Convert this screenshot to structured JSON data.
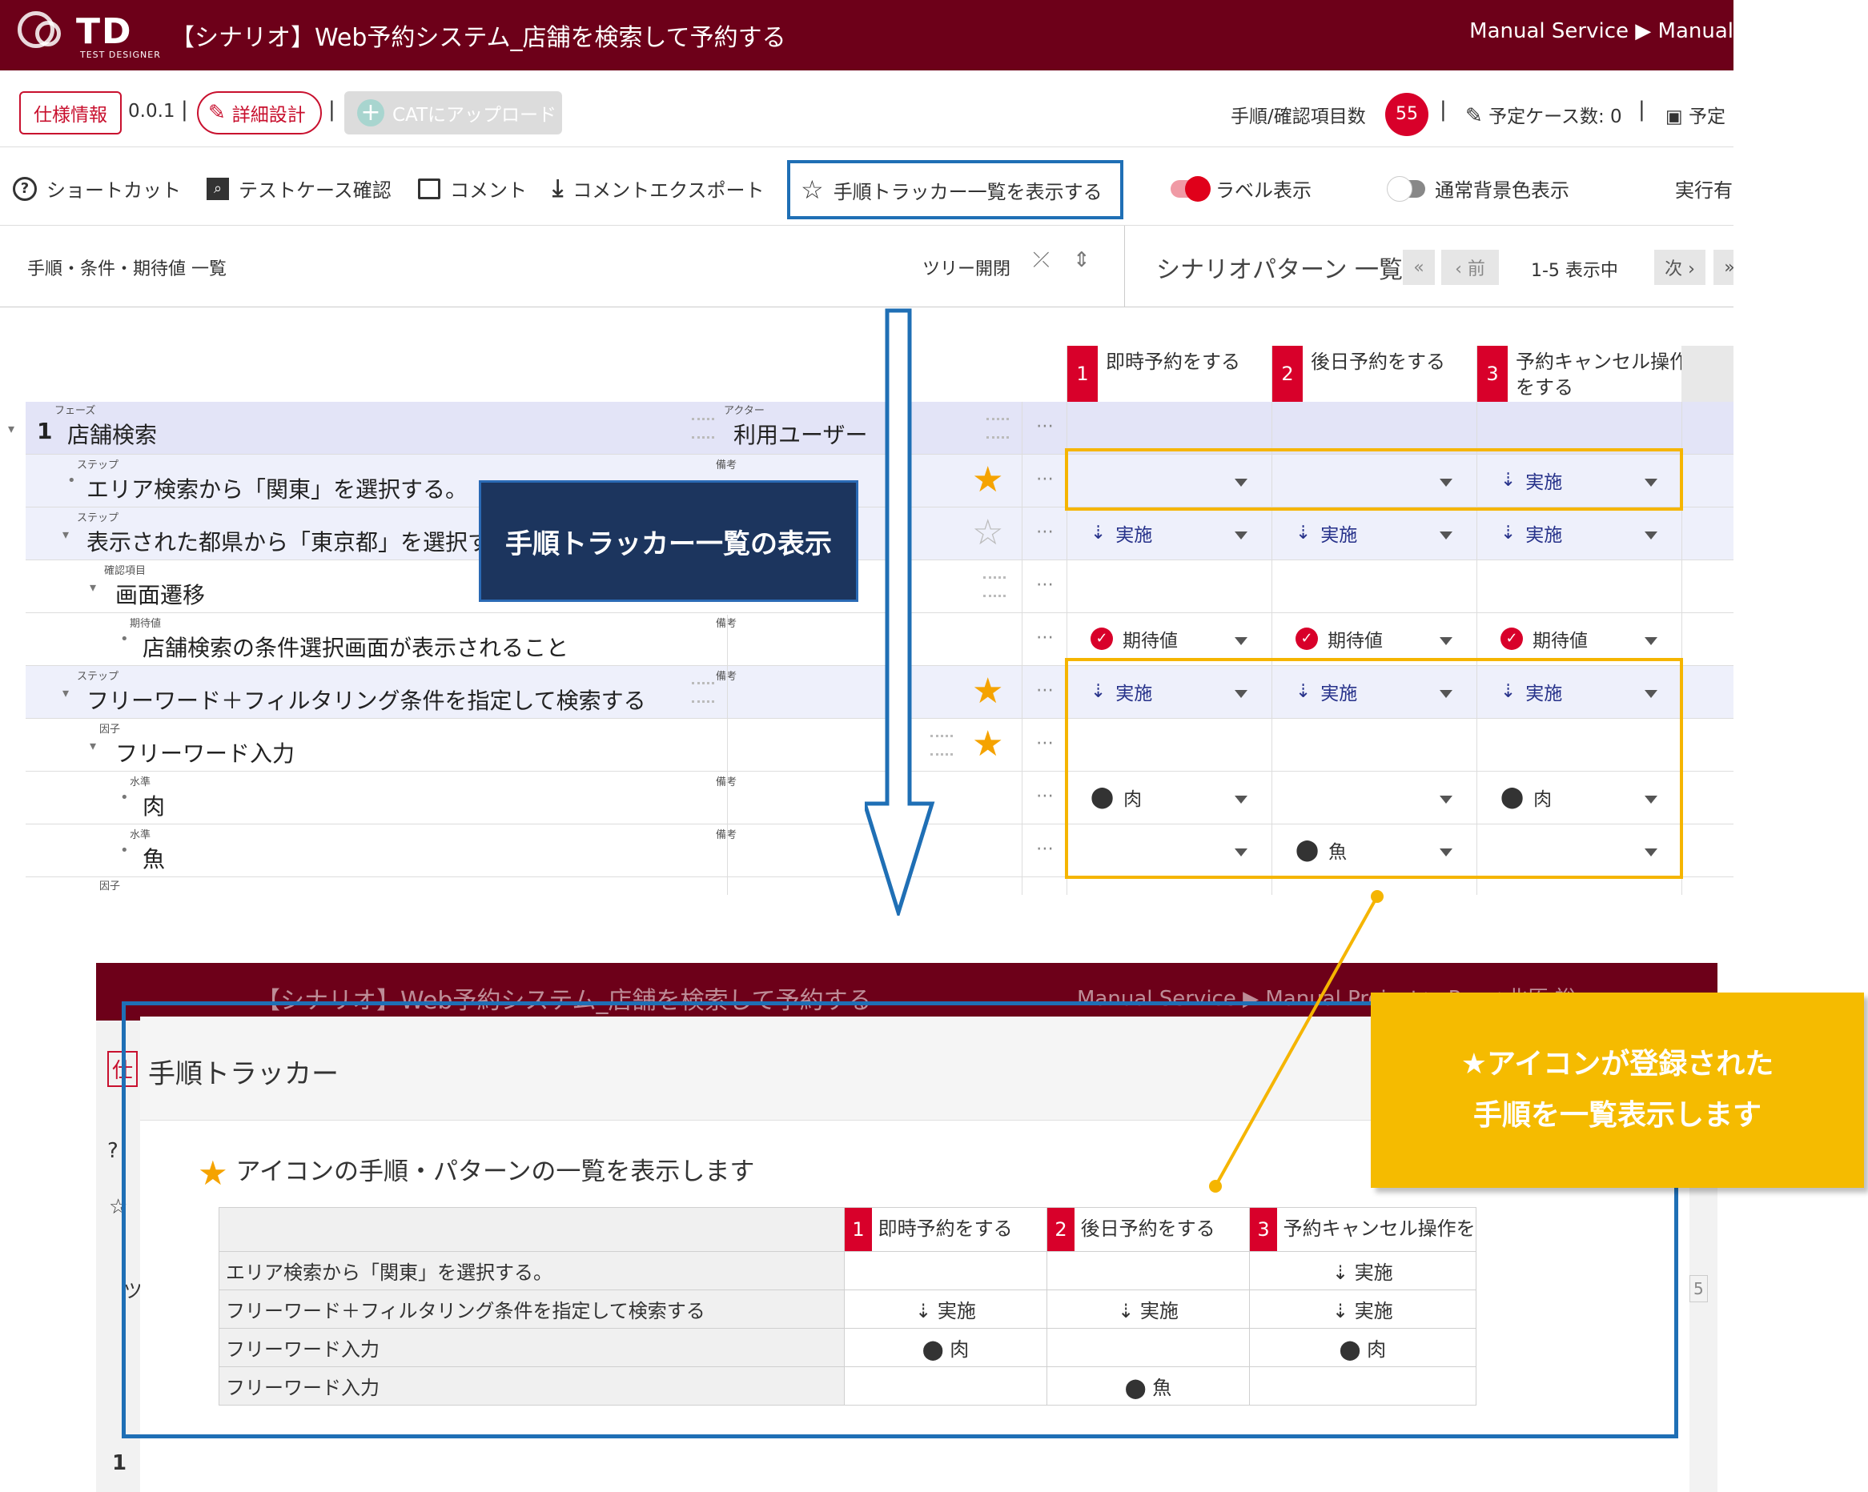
{
  "app": {
    "logo": "TD",
    "logo_sub": "TEST DESIGNER",
    "title": "【シナリオ】Web予約システム_店舗を検索して予約する",
    "breadcrumb": "Manual Service ▶ Manual"
  },
  "toolbar1": {
    "spec_label": "仕様情報",
    "version": "0.0.1",
    "separator": "|",
    "detail_label": "詳細設計",
    "cat_label": "CATにアップロード",
    "count_label": "手順/確認項目数",
    "count_value": "55",
    "planned_label": "予定ケース数: 0",
    "planned2_label": "予定"
  },
  "toolbar2": {
    "shortcut": "ショートカット",
    "testcase": "テストケース確認",
    "comment": "コメント",
    "comment_export": "コメントエクスポート",
    "tracker": "手順トラッカー一覧を表示する",
    "label_toggle": "ラベル表示",
    "bg_toggle": "通常背景色表示",
    "run": "実行有"
  },
  "panes": {
    "left_title": "手順・条件・期待値 一覧",
    "tree_toggle": "ツリー開閉",
    "right_title": "シナリオパターン 一覧",
    "first": "«",
    "prev": "‹ 前",
    "range": "1-5 表示中",
    "next": "次 ›",
    "last": "»"
  },
  "patterns": [
    {
      "num": "1",
      "label": "即時予約をする"
    },
    {
      "num": "2",
      "label": "後日予約をする"
    },
    {
      "num": "3",
      "label": "予約キャンセル操作をする"
    }
  ],
  "tree": {
    "phase_tag": "フェーズ",
    "phase_num": "1",
    "phase_name": "店舗検索",
    "actor_tag": "アクター",
    "actor_name": "利用ユーザー",
    "step_tag": "ステップ",
    "note_tag": "備考",
    "check_tag": "確認項目",
    "expect_tag": "期待値",
    "factor_tag": "因子",
    "level_tag": "水準",
    "step1": "エリア検索から「関東」を選択する。",
    "step2": "表示された都県から「東京都」を選択する",
    "check1": "画面遷移",
    "expect1": "店舗検索の条件選択画面が表示されること",
    "step3": "フリーワード＋フィルタリング条件を指定して検索する",
    "factor1": "フリーワード入力",
    "level1": "肉",
    "level2": "魚"
  },
  "cells": {
    "do": "実施",
    "expect": "期待値",
    "meat": "肉",
    "fish": "魚",
    "more": "⋯"
  },
  "callouts": {
    "navy": "手順トラッカー一覧の表示",
    "yellow_line1": "★アイコンが登録された",
    "yellow_line2": "手順を一覧表示します"
  },
  "bottom": {
    "title": "【シナリオ】Web予約システム_店舗を検索して予約する",
    "breadcrumb": "Manual Service ▶ Manual Project ▶ P... ◀ 北原 裕",
    "spec_fragment": "仕",
    "side_fragment": "ツ",
    "page_fragment": "5",
    "row_num": "1",
    "modal_title": "手順トラッカー",
    "modal_sub": "アイコンの手順・パターンの一覧を表示します",
    "col3_trunc": "予約キャンセル操作を",
    "rows": [
      {
        "name": "エリア検索から「関東」を選択する。",
        "c1": "",
        "c2": "",
        "c3": "実施"
      },
      {
        "name": "フリーワード＋フィルタリング条件を指定して検索する",
        "c1": "実施",
        "c2": "実施",
        "c3": "実施"
      },
      {
        "name": "フリーワード入力",
        "c1": "肉",
        "c2": "",
        "c3": "肉"
      },
      {
        "name": "フリーワード入力",
        "c1": "",
        "c2": "魚",
        "c3": ""
      }
    ]
  },
  "colors": {
    "brand": "#6d0019",
    "accent_red": "#d8002a",
    "highlight_blue": "#1f6fb5",
    "highlight_yellow": "#f5b500",
    "phase_bg": "#e3e4f7",
    "star": "#f5a300"
  }
}
